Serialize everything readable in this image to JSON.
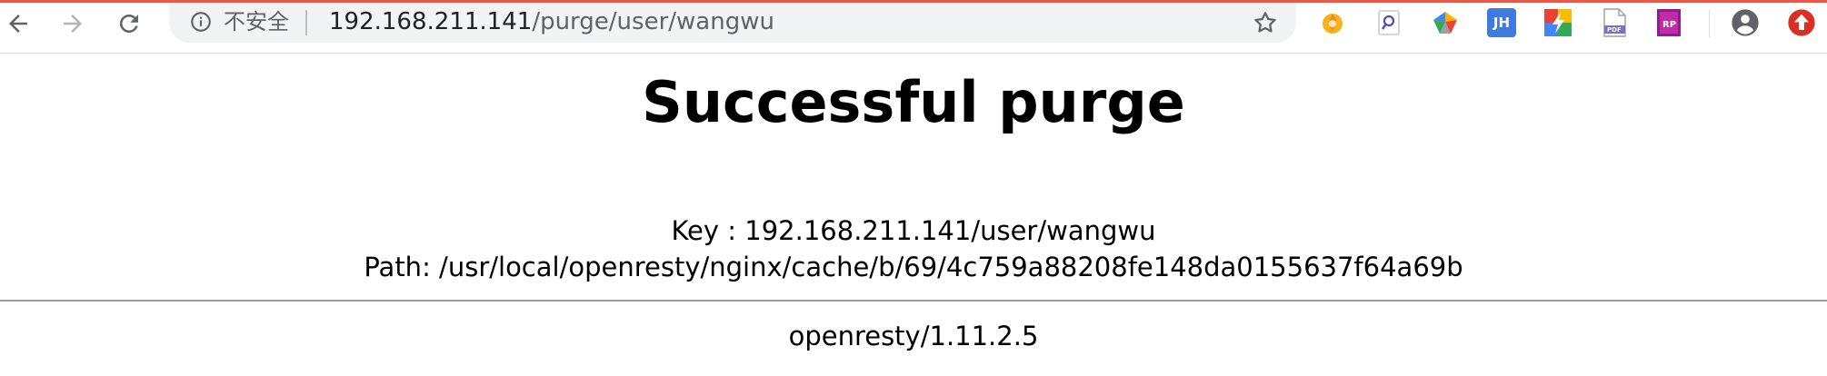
{
  "browser": {
    "security_label": "不安全",
    "url_host": "192.168.211.141",
    "url_path": "/purge/user/wangwu",
    "accent_color": "#e8594a",
    "icons": {
      "back": "arrow-left-icon",
      "forward": "arrow-right-icon",
      "reload": "reload-icon",
      "info": "info-icon",
      "bookmark": "star-icon",
      "profile": "account-circle-icon",
      "update": "update-arrow-icon"
    },
    "extensions": [
      {
        "name": "orange-extension",
        "text": ""
      },
      {
        "name": "search-extension",
        "text": ""
      },
      {
        "name": "colorful-extension",
        "text": ""
      },
      {
        "name": "jh-extension",
        "text": "JH"
      },
      {
        "name": "bolt-extension",
        "text": ""
      },
      {
        "name": "pdf-extension",
        "text": "PDF"
      },
      {
        "name": "rp-extension",
        "text": "RP"
      }
    ]
  },
  "page": {
    "title": "Successful purge",
    "key_line": "Key : 192.168.211.141/user/wangwu",
    "path_line": "Path: /usr/local/openresty/nginx/cache/b/69/4c759a88208fe148da0155637f64a69b",
    "server": "openresty/1.11.2.5"
  }
}
